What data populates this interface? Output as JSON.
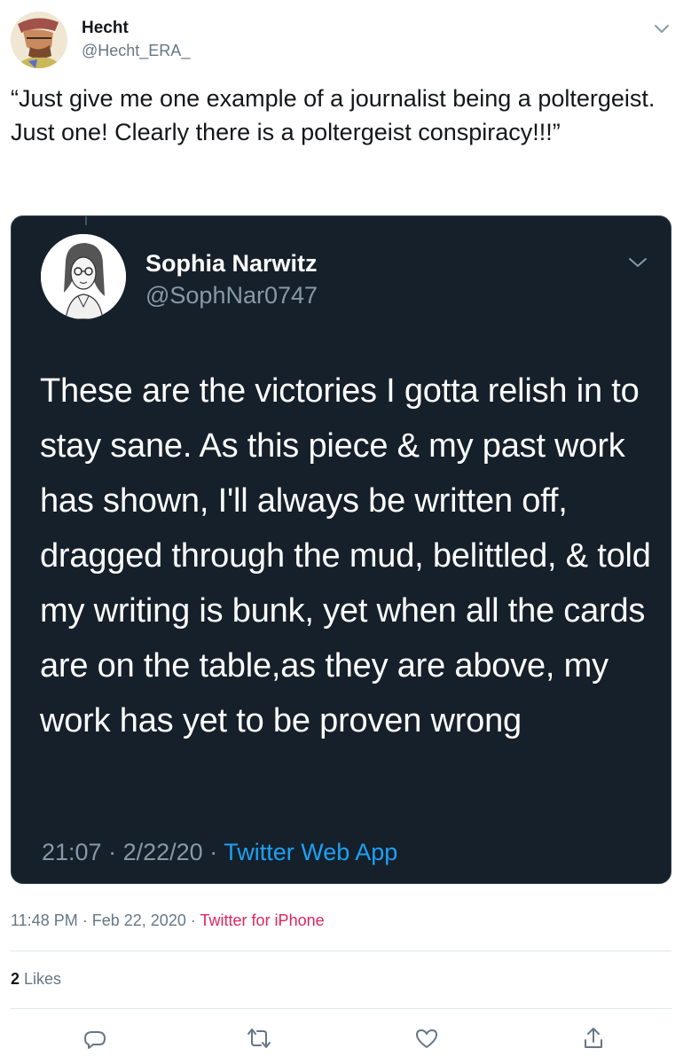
{
  "author": {
    "name": "Hecht",
    "handle": "@Hecht_ERA_"
  },
  "tweet_text": "“Just give me one example of a journalist being a poltergeist. Just one! Clearly there is a poltergeist conspiracy!!!”",
  "quoted_screenshot": {
    "name": "Sophia Narwitz",
    "handle": "@SophNar0747",
    "text": "These are the victories I gotta relish in to stay sane. As this piece & my past work has shown, I'll always be written off, dragged through the mud, belittled, & told my writing is bunk, yet when all the cards are on the table,as they are above, my work has yet to be proven wrong",
    "time": "21:07",
    "date": "2/22/20",
    "separator": "·",
    "source": "Twitter Web App"
  },
  "meta": {
    "time": "11:48 PM",
    "separator": "·",
    "date": "Feb 22, 2020",
    "source": "Twitter for iPhone"
  },
  "stats": {
    "likes_count": "2",
    "likes_label": "Likes"
  },
  "actions": [
    "reply-icon",
    "retweet-icon",
    "like-icon",
    "share-icon"
  ],
  "colors": {
    "card_background": "#15202b",
    "link_blue": "#1da1f2",
    "source_pink": "#e0245e",
    "secondary_text": "#657786"
  }
}
